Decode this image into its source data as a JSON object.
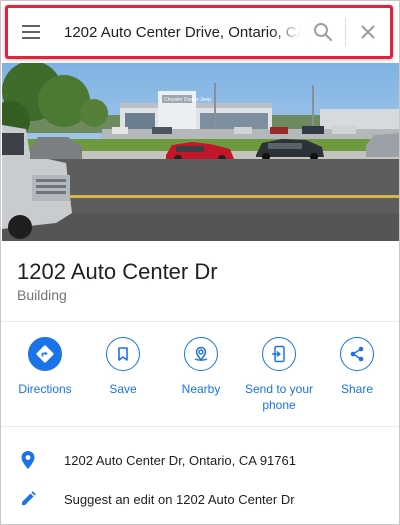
{
  "search": {
    "value": "1202 Auto Center Drive, Ontario, CA",
    "icons": {
      "menu": "menu-icon",
      "search": "search-icon",
      "clear": "close-icon"
    }
  },
  "place": {
    "title": "1202 Auto Center Dr",
    "category": "Building",
    "storefront_sign": "Chrysler Dodge Jeep"
  },
  "actions": [
    {
      "label": "Directions",
      "icon": "directions-icon",
      "filled": true
    },
    {
      "label": "Save",
      "icon": "bookmark-icon"
    },
    {
      "label": "Nearby",
      "icon": "nearby-icon"
    },
    {
      "label": "Send to your phone",
      "icon": "send-to-phone-icon"
    },
    {
      "label": "Share",
      "icon": "share-icon"
    }
  ],
  "info": [
    {
      "icon": "location-pin-icon",
      "text": "1202 Auto Center Dr, Ontario, CA 91761"
    },
    {
      "icon": "edit-pencil-icon",
      "text": "Suggest an edit on 1202 Auto Center Dr"
    }
  ],
  "colors": {
    "accent": "#1a73e8",
    "highlight_border": "#e0243f",
    "secondary_text": "#70757a"
  }
}
